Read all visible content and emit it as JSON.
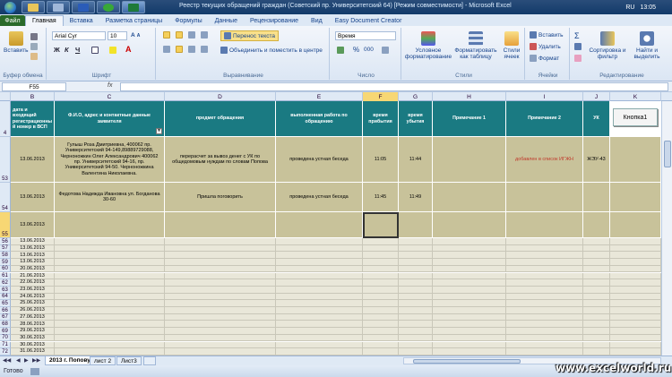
{
  "taskbar": {
    "lang": "RU",
    "time": "13:05"
  },
  "window": {
    "title": "Реестр текущих обращений граждан (Советский пр. Университетский 64)  [Режим совместимости]  -  Microsoft Excel"
  },
  "ribbon": {
    "file_tab": "Файл",
    "tabs": [
      "Главная",
      "Вставка",
      "Разметка страницы",
      "Формулы",
      "Данные",
      "Рецензирование",
      "Вид",
      "Easy Document Creator"
    ],
    "paste_label": "Вставить",
    "font_name": "Arial Cyr",
    "font_size": "10",
    "wrap_text": "Перенос текста",
    "merge_center": "Объединить и поместить в центре",
    "number_format": "Время",
    "cond_format": "Условное форматирование",
    "format_table": "Форматировать как таблицу",
    "cell_styles": "Стили ячеек",
    "insert": "Вставить",
    "delete": "Удалить",
    "format": "Формат",
    "sort_filter": "Сортировка и фильтр",
    "find_select": "Найти и выделить",
    "groups": {
      "clipboard": "Буфер обмена",
      "font": "Шрифт",
      "alignment": "Выравнивание",
      "number": "Число",
      "styles": "Стили",
      "cells": "Ячейки",
      "editing": "Редактирование"
    },
    "bold": "Ж",
    "italic": "К",
    "underline": "Ч",
    "percent": "%",
    "thousands": "000"
  },
  "formula_bar": {
    "name_box": "F55",
    "fx": "fx",
    "value": ""
  },
  "columns": [
    "B",
    "C",
    "D",
    "E",
    "F",
    "G",
    "H",
    "I",
    "J",
    "K"
  ],
  "header_row": {
    "row_num": "4",
    "B": "дата и входящий регистрационны й номер в ВСП",
    "C": "Ф.И.О, адрес и  контактные данные заявителя",
    "D": "предмет обращения",
    "E": "выполненная работа по обращению",
    "F": "время прибытия",
    "G": "время убытия",
    "H": "Примечание 1",
    "I": "Примечание 2",
    "J": "УК",
    "K": "Кнопка1"
  },
  "data_rows": [
    {
      "row_num": "53",
      "B": "13.06.2013",
      "C": "Гулыш Роза Дмитриевна, 400062 пр. Университетский 94-149,89889729088, Черноножкин Олег Александрович 400062 пр. Университетский 94-16, пр. Университетский 94-50. Черноножкина Валентина Николаевна.",
      "D": "перерасчет за вывоз денег с УК по общедомовым нуждам по словам Попова",
      "E": "проведена устная беседа",
      "F": "11:05",
      "G": "11:44",
      "H": "",
      "I": "добавлен в список ИГЖН",
      "J": "ЖЭУ-43"
    },
    {
      "row_num": "54",
      "B": "13.06.2013",
      "C": "Федотова Надежда Ивановна ул. Богданова 30-60",
      "D": "Пришла поговорить",
      "E": "проведена устная беседа",
      "F": "11:45",
      "G": "11:49",
      "H": "",
      "I": "",
      "J": ""
    },
    {
      "row_num": "55",
      "B": "13.06.2013",
      "C": "",
      "D": "",
      "E": "",
      "F": "",
      "G": "",
      "H": "",
      "I": "",
      "J": ""
    }
  ],
  "small_rows": [
    {
      "n": "56",
      "d": "13.06.2013"
    },
    {
      "n": "57",
      "d": "13.06.2013"
    },
    {
      "n": "58",
      "d": "13.06.2013"
    },
    {
      "n": "59",
      "d": "13.06.2013"
    },
    {
      "n": "60",
      "d": "20.06.2013"
    },
    {
      "n": "61",
      "d": "21.06.2013"
    },
    {
      "n": "62",
      "d": "22.06.2013"
    },
    {
      "n": "63",
      "d": "23.06.2013"
    },
    {
      "n": "64",
      "d": "24.06.2013"
    },
    {
      "n": "65",
      "d": "25.06.2013"
    },
    {
      "n": "66",
      "d": "26.06.2013"
    },
    {
      "n": "67",
      "d": "27.06.2013"
    },
    {
      "n": "68",
      "d": "28.06.2013"
    },
    {
      "n": "69",
      "d": "29.06.2013"
    },
    {
      "n": "70",
      "d": "30.06.2013"
    },
    {
      "n": "71",
      "d": "30.06.2013"
    },
    {
      "n": "72",
      "d": "31.06.2013"
    }
  ],
  "sheets": [
    "2013 г. Попову",
    "лист 2",
    "Лист3"
  ],
  "status": "Готово",
  "watermark": "www.excelworld.ru",
  "colors": {
    "header_teal": "#1a7a82",
    "row_tan": "#c8c29a",
    "empty_rows": "#e9e7d9",
    "note_red": "#c0392b",
    "selection_yellow": "#f7d774"
  }
}
